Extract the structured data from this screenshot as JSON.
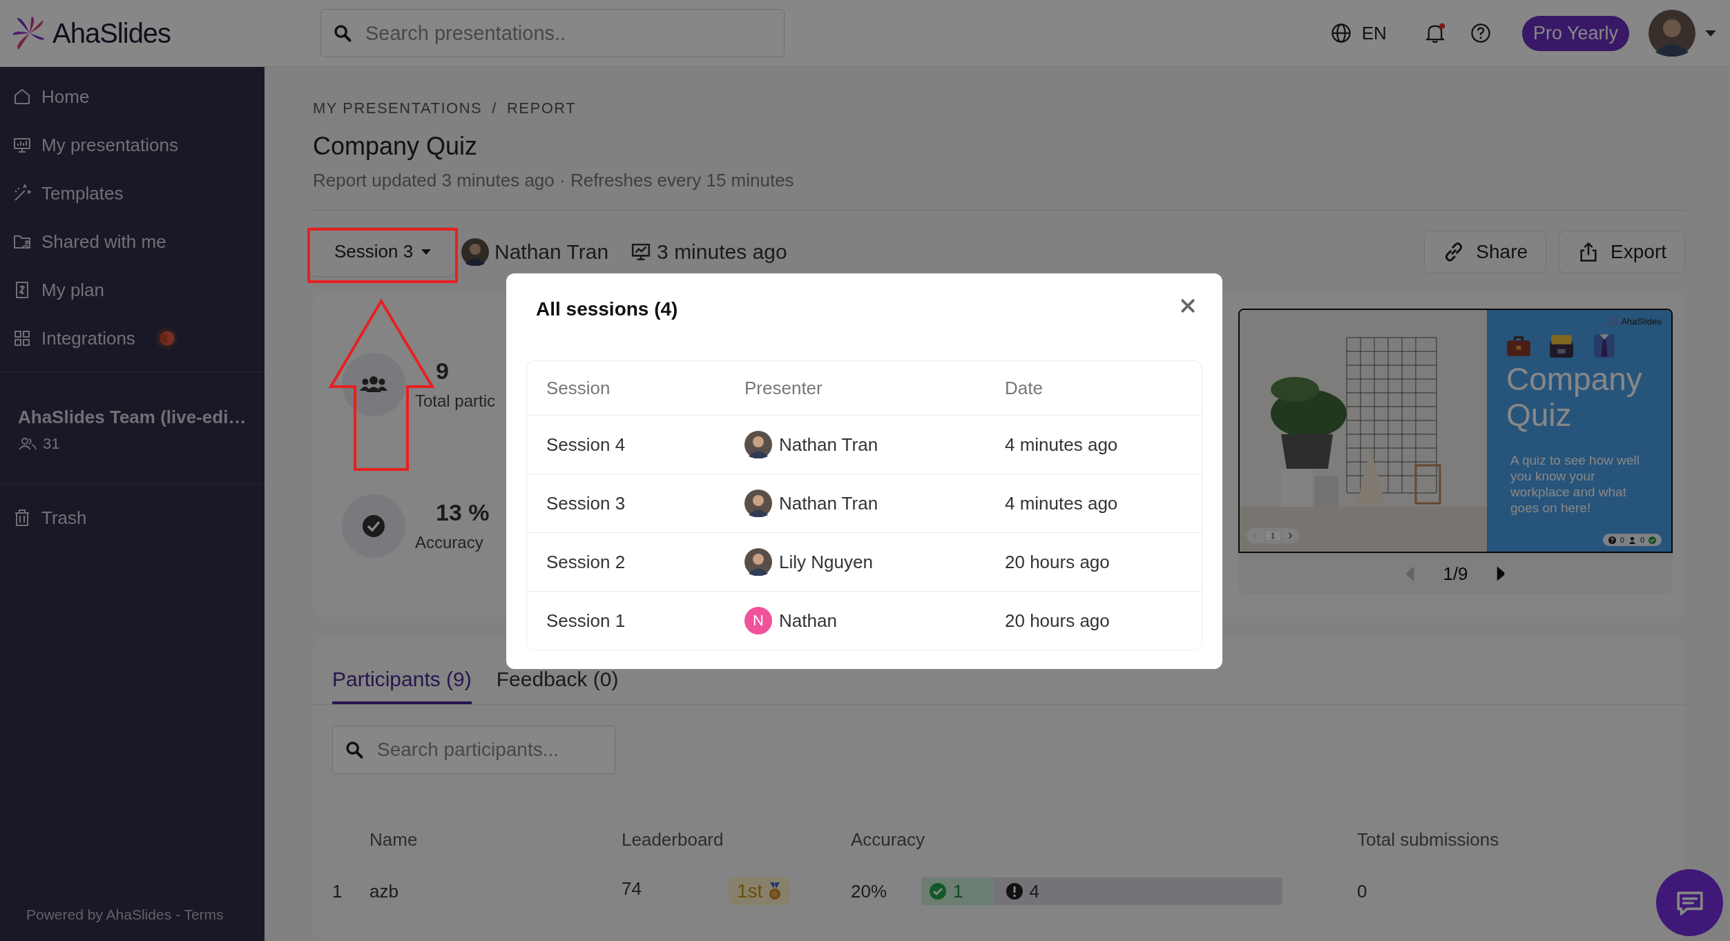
{
  "topbar": {
    "brand": "AhaSlides",
    "search_placeholder": "Search presentations..",
    "language": "EN",
    "unread": true,
    "plan": "Pro Yearly"
  },
  "sidebar": {
    "items": [
      {
        "label": "Home"
      },
      {
        "label": "My presentations"
      },
      {
        "label": "Templates"
      },
      {
        "label": "Shared with me"
      },
      {
        "label": "My plan"
      },
      {
        "label": "Integrations"
      }
    ],
    "team": {
      "name": "AhaSlides Team (live-edi…",
      "members": "31"
    },
    "trash": "Trash",
    "footer": {
      "text": "Powered by AhaSlides -",
      "link": "Terms"
    }
  },
  "breadcrumb": {
    "items": [
      "MY PRESENTATIONS",
      "REPORT"
    ],
    "separator": "/"
  },
  "title": "Company Quiz",
  "subtitle": "Report updated 3 minutes ago · Refreshes every 15 minutes",
  "session_bar": {
    "session": "Session 3",
    "presenter": "Nathan Tran",
    "time": "3 minutes ago",
    "actions": [
      "Share",
      "Export"
    ]
  },
  "stats": [
    {
      "value": "9",
      "label": "Total partic"
    },
    {
      "value": "13 %",
      "label": "Accuracy"
    }
  ],
  "preview": {
    "slide": {
      "brand": "AhaSlides",
      "title": "Company Quiz",
      "description": "A quiz to see how well you know your workplace and what goes on here!",
      "page": "1",
      "counts": [
        "0",
        "0"
      ]
    },
    "position": "1/9",
    "prev": {
      "disabled": true
    },
    "next": {
      "disabled": false
    }
  },
  "tabs": [
    {
      "label": "Participants (9)",
      "selected": true
    },
    {
      "label": "Feedback (0)",
      "selected": false
    }
  ],
  "participant_search": {
    "placeholder": "Search participants..."
  },
  "participants": {
    "columns": [
      "Name",
      "Leaderboard",
      "Accuracy",
      "Total submissions"
    ],
    "rows": [
      {
        "rank": "1",
        "name": "azb",
        "score": "74",
        "place": "1st",
        "accuracy": "20%",
        "correct": "1",
        "incorrect": "4",
        "level": 0.2,
        "submissions": "0"
      }
    ]
  },
  "modal": {
    "title": "All sessions (4)",
    "columns": [
      "Session",
      "Presenter",
      "Date"
    ],
    "rows": [
      {
        "session": "Session 4",
        "presenter": "Nathan Tran",
        "date": "4 minutes ago"
      },
      {
        "session": "Session 3",
        "presenter": "Nathan Tran",
        "date": "4 minutes ago"
      },
      {
        "session": "Session 2",
        "presenter": "Lily Nguyen",
        "date": "20 hours ago"
      },
      {
        "session": "Session 1",
        "presenter": "Nathan",
        "avatar": {
          "kind": "initial",
          "initial": "N",
          "color": "#f0529c"
        },
        "date": "20 hours ago"
      }
    ]
  }
}
